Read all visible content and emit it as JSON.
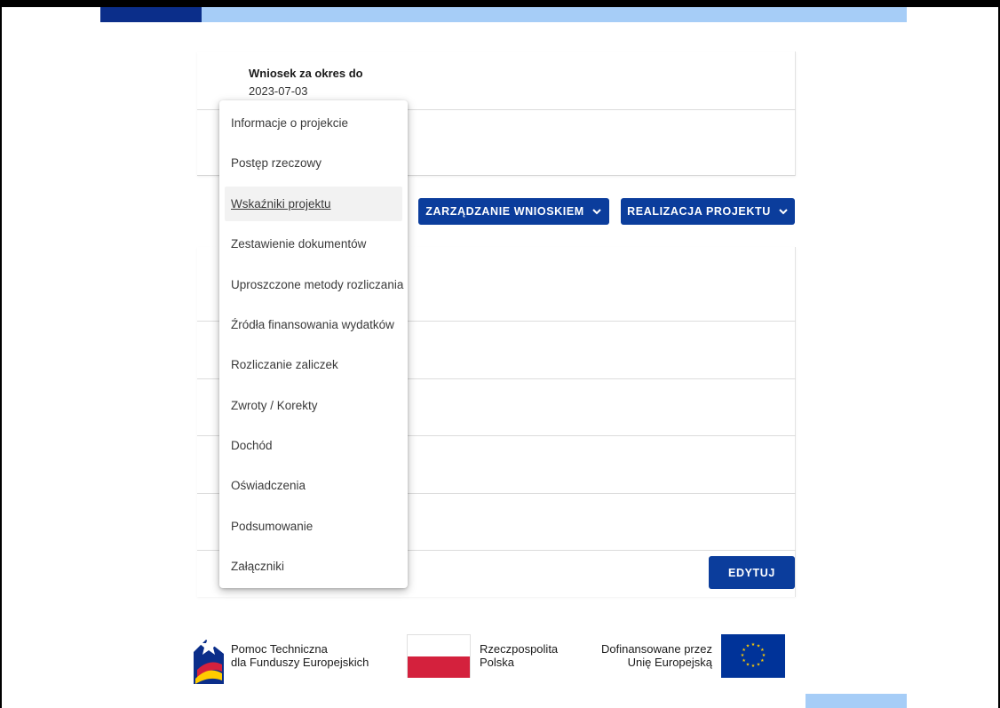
{
  "colors": {
    "primary": "#0b3d9c",
    "dark_bar": "#0b2e8a",
    "light_bar": "#a6cdf7",
    "poland_red": "#d4213d",
    "eu_blue": "#003399",
    "eu_star": "#ffcc00"
  },
  "card": {
    "period_label": "Wniosek za okres do",
    "period_value": "2023-07-03"
  },
  "toolbar": {
    "zarzadzanie_label": "ZARZĄDZANIE WNIOSKIEM",
    "realizacja_label": "REALIZACJA PROJEKTU",
    "edytuj_label": "EDYTUJ",
    "chevron_icon": "chevron-down-icon"
  },
  "menu": {
    "hovered_index": 2,
    "items": [
      {
        "label": "Informacje o projekcie"
      },
      {
        "label": "Postęp rzeczowy"
      },
      {
        "label": "Wskaźniki projektu"
      },
      {
        "label": "Zestawienie dokumentów"
      },
      {
        "label": "Uproszczone metody rozliczania"
      },
      {
        "label": "Źródła finansowania wydatków"
      },
      {
        "label": "Rozliczanie zaliczek"
      },
      {
        "label": "Zwroty / Korekty"
      },
      {
        "label": "Dochód"
      },
      {
        "label": "Oświadczenia"
      },
      {
        "label": "Podsumowanie"
      },
      {
        "label": "Załączniki"
      }
    ]
  },
  "footer": {
    "pomoc_line1": "Pomoc Techniczna",
    "pomoc_line2": "dla Funduszy Europejskich",
    "rp_line1": "Rzeczpospolita",
    "rp_line2": "Polska",
    "dof_line1": "Dofinansowane przez",
    "dof_line2": "Unię Europejską"
  }
}
